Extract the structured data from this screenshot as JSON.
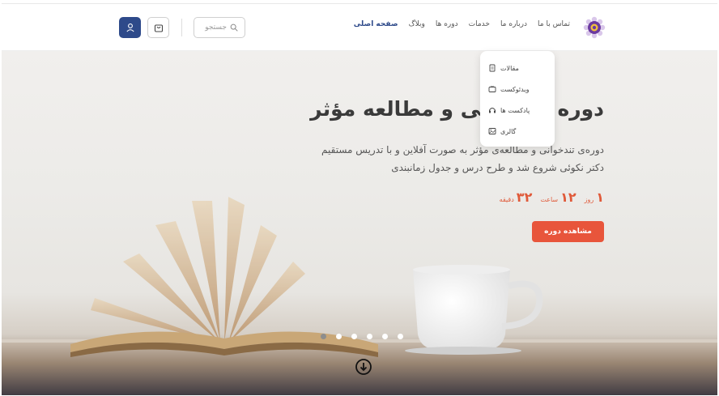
{
  "header": {
    "nav": [
      {
        "label": "صفحه اصلی",
        "active": true
      },
      {
        "label": "وبلاگ",
        "active": false
      },
      {
        "label": "دوره ها",
        "active": false
      },
      {
        "label": "خدمات",
        "active": false
      },
      {
        "label": "درباره ما",
        "active": false
      },
      {
        "label": "تماس با ما",
        "active": false
      }
    ],
    "search_placeholder": "جستجو",
    "icons": {
      "logo": "brand-logo-icon",
      "search": "search-icon",
      "cart": "shopping-bag-icon",
      "user": "user-icon"
    }
  },
  "dropdown": {
    "items": [
      {
        "label": "مقالات",
        "icon": "document-icon"
      },
      {
        "label": "ویدئوکست",
        "icon": "tv-icon"
      },
      {
        "label": "پادکست ها",
        "icon": "headphones-icon"
      },
      {
        "label": "گالری",
        "icon": "image-icon"
      }
    ]
  },
  "hero": {
    "title": "دوره تندخوانی و مطالعه مؤثر",
    "description": "دوره‌ی تندخوانی و مطالعه‌ی مؤثر به صورت آفلاین و با تدریس مستقیم دکتر نکوئی شروع شد و طرح درس و جدول زمانبندی",
    "countdown": [
      {
        "value": "۱",
        "unit": "روز"
      },
      {
        "value": "۱۲",
        "unit": "ساعت"
      },
      {
        "value": "۳۲",
        "unit": "دقیقه"
      }
    ],
    "cta_label": "مشاهده دوره",
    "slides_count": 6,
    "active_slide": 0
  },
  "colors": {
    "brand": "#2e4a8a",
    "accent": "#e8553b"
  }
}
